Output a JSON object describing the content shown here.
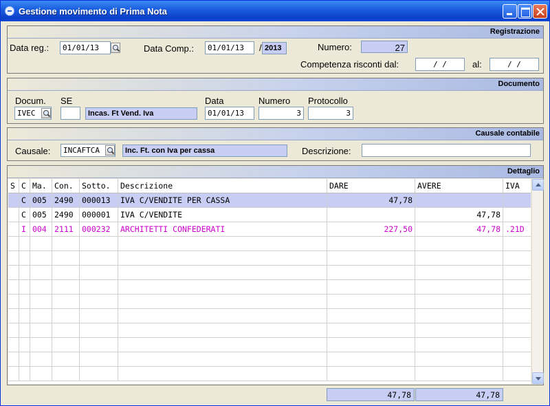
{
  "window": {
    "title": "Gestione movimento di Prima Nota"
  },
  "registrazione": {
    "section_title": "Registrazione",
    "data_reg_label": "Data reg.:",
    "data_reg_value": "01/01/13",
    "data_comp_label": "Data Comp.:",
    "data_comp_value": "01/01/13",
    "separator": "/",
    "anno": "2013",
    "numero_label": "Numero:",
    "numero_value": "27",
    "competenza_label": "Competenza risconti dal:",
    "competenza_dal": " /  /",
    "al_label": "al:",
    "competenza_al": " /  /"
  },
  "documento": {
    "section_title": "Documento",
    "docum_label": "Docum.",
    "docum_value": "IVEC",
    "se_label": "SE",
    "se_value": "",
    "docum_desc": "Incas. Ft Vend. Iva",
    "data_label": "Data",
    "data_value": "01/01/13",
    "numero_label": "Numero",
    "numero_value": "3",
    "protocollo_label": "Protocollo",
    "protocollo_value": "3"
  },
  "causale": {
    "section_title": "Causale contabile",
    "causale_label": "Causale:",
    "causale_value": "INCAFTCA",
    "causale_desc": "Inc. Ft. con Iva per cassa",
    "descrizione_label": "Descrizione:",
    "descrizione_value": ""
  },
  "dettaglio": {
    "section_title": "Dettaglio",
    "columns": [
      "S",
      "C",
      "Ma.",
      "Con.",
      "Sotto.",
      "Descrizione",
      "DARE",
      "AVERE",
      "IVA"
    ],
    "rows": [
      {
        "s": "",
        "c": "C",
        "ma": "005",
        "con": "2490",
        "sotto": "000013",
        "descrizione": "IVA C/VENDITE PER CASSA",
        "dare": "47,78",
        "avere": "",
        "iva": ""
      },
      {
        "s": "",
        "c": "C",
        "ma": "005",
        "con": "2490",
        "sotto": "000001",
        "descrizione": "IVA C/VENDITE",
        "dare": "",
        "avere": "47,78",
        "iva": ""
      },
      {
        "s": "",
        "c": "I",
        "ma": "004",
        "con": "2111",
        "sotto": "000232",
        "descrizione": "ARCHITETTI CONFEDERATI",
        "dare": "227,50",
        "avere": "47,78",
        "iva": ".21D"
      }
    ],
    "totale_dare": "47,78",
    "totale_avere": "47,78"
  },
  "colors": {
    "selected_row": "#c7cdf3",
    "highlight_text": "#cc00cc",
    "title_bar": "#0a3fc8"
  }
}
